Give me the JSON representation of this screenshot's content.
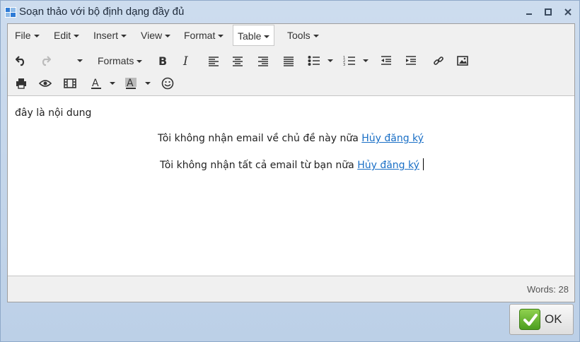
{
  "window": {
    "title": "Soạn thảo với bộ định dạng đầy đủ"
  },
  "menubar": {
    "items": [
      "File",
      "Edit",
      "Insert",
      "View",
      "Format",
      "Table",
      "Tools"
    ],
    "active": "Table"
  },
  "toolbar": {
    "formats_label": "Formats",
    "row1": [
      "undo-icon",
      "redo-icon",
      "font-size-dropdown",
      "formats-dropdown",
      "bold-icon",
      "italic-icon",
      "align-left-icon",
      "align-center-icon",
      "align-right-icon",
      "align-justify-icon",
      "bullet-list-icon",
      "numbered-list-icon",
      "outdent-icon",
      "indent-icon",
      "link-icon",
      "image-icon"
    ],
    "row2": [
      "print-icon",
      "preview-icon",
      "media-icon",
      "text-color-icon",
      "background-color-icon",
      "emoticons-icon"
    ],
    "text_color_glyph": "A",
    "background_color_glyph": "A"
  },
  "content": {
    "line1": "đây là nội dung",
    "line2_text": "Tôi không nhận email về chủ đề này nữa ",
    "line2_link": "Hủy đăng ký",
    "line3_text": "Tôi không nhận tất cả email từ bạn nữa ",
    "line3_link": "Hủy đăng ký"
  },
  "status": {
    "word_count": "Words: 28"
  },
  "footer": {
    "ok_label": "OK"
  },
  "colors": {
    "window_bg": "#bfd3e9",
    "link": "#1a6fc6",
    "ok_check": "#6bb838"
  }
}
